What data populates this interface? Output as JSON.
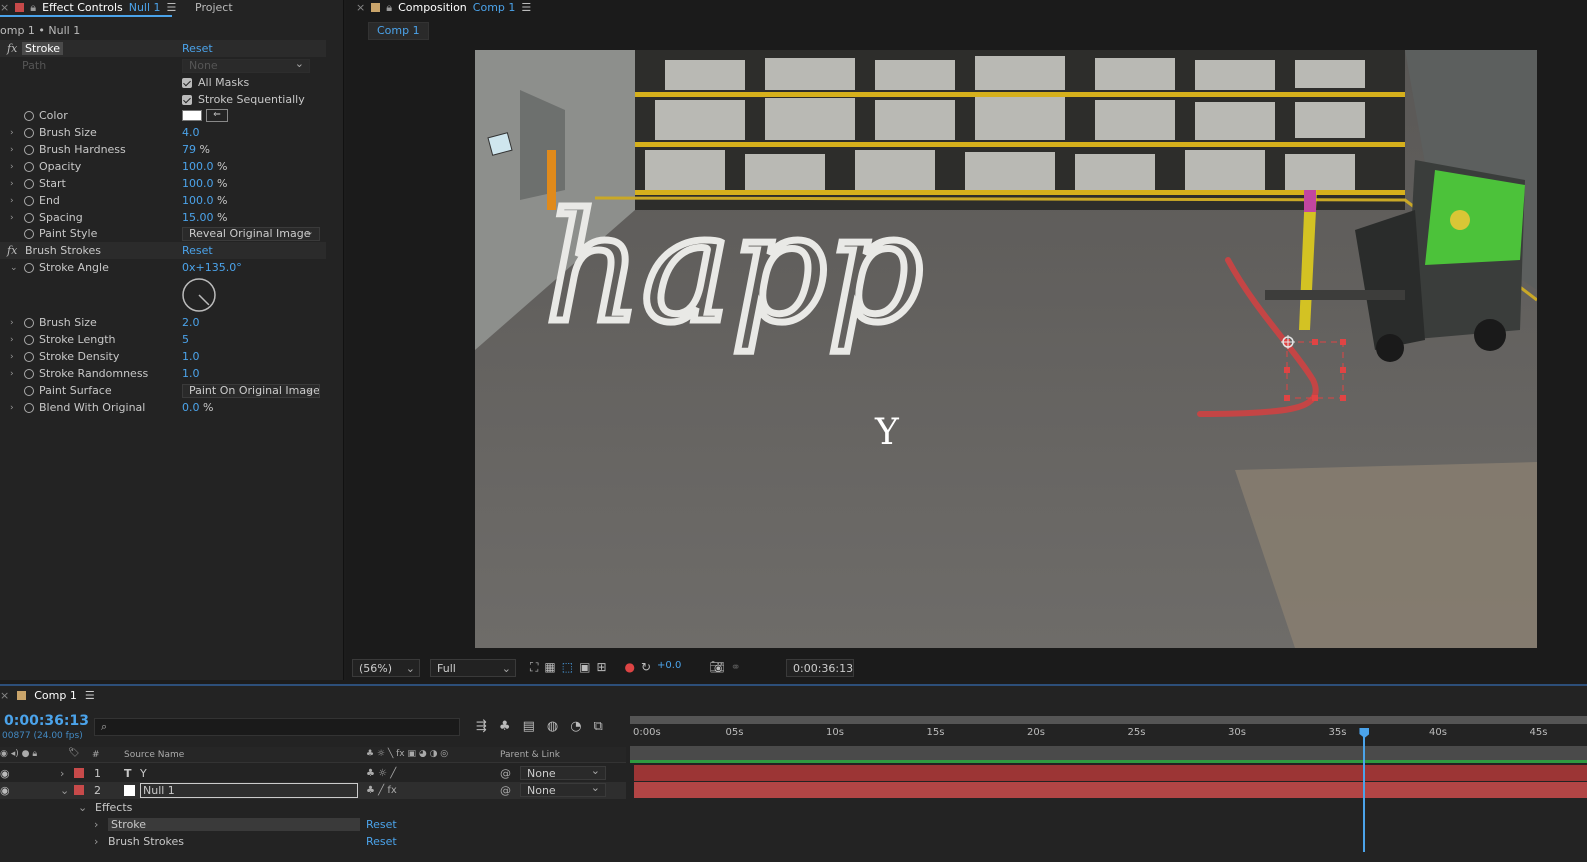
{
  "effect_controls": {
    "tab_title": "Effect Controls",
    "tab_layer": "Null 1",
    "project_tab": "Project",
    "breadcrumb": "omp 1 • Null 1",
    "stroke": {
      "name": "Stroke",
      "reset": "Reset",
      "path_label": "Path",
      "path_value": "None",
      "all_masks": "All Masks",
      "stroke_sequentially": "Stroke Sequentially",
      "color_label": "Color",
      "color_value": "#ffffff",
      "props": [
        {
          "label": "Brush Size",
          "value": "4.0",
          "unit": ""
        },
        {
          "label": "Brush Hardness",
          "value": "79",
          "unit": "%"
        },
        {
          "label": "Opacity",
          "value": "100.0",
          "unit": "%"
        },
        {
          "label": "Start",
          "value": "100.0",
          "unit": "%"
        },
        {
          "label": "End",
          "value": "100.0",
          "unit": "%"
        },
        {
          "label": "Spacing",
          "value": "15.00",
          "unit": "%"
        }
      ],
      "paint_style_label": "Paint Style",
      "paint_style_value": "Reveal Original Image"
    },
    "brush_strokes": {
      "name": "Brush Strokes",
      "reset": "Reset",
      "angle_label": "Stroke Angle",
      "angle_value": "0x+135.0°",
      "angle_degrees": 135,
      "props": [
        {
          "label": "Brush Size",
          "value": "2.0",
          "unit": ""
        },
        {
          "label": "Stroke Length",
          "value": "5",
          "unit": ""
        },
        {
          "label": "Stroke Density",
          "value": "1.0",
          "unit": ""
        },
        {
          "label": "Stroke Randomness",
          "value": "1.0",
          "unit": ""
        }
      ],
      "paint_surface_label": "Paint Surface",
      "paint_surface_value": "Paint On Original Image",
      "blend_label": "Blend With Original",
      "blend_value": "0.0",
      "blend_unit": "%"
    }
  },
  "composition": {
    "tab_title": "Composition",
    "tab_comp": "Comp 1",
    "sub_tab": "Comp 1",
    "viewer_text": "happ",
    "viewer_letter": "Y",
    "zoom": "(56%)",
    "resolution": "Full",
    "exposure": "+0.0",
    "timecode": "0:00:36:13"
  },
  "timeline": {
    "tab": "Comp 1",
    "timecode": "0:00:36:13",
    "frames": "00877 (24.00 fps)",
    "search_placeholder": "",
    "col_num": "#",
    "col_source": "Source Name",
    "col_parent": "Parent & Link",
    "ruler": [
      "0:00s",
      "05s",
      "10s",
      "15s",
      "20s",
      "25s",
      "30s",
      "35s",
      "40s",
      "45s"
    ],
    "playhead_seconds": 36.54,
    "layers": [
      {
        "num": "1",
        "type": "T",
        "name": "Y",
        "color": "#c74a4a",
        "parent": "None"
      },
      {
        "num": "2",
        "type": "",
        "name": "Null 1",
        "color": "#c74a4a",
        "parent": "None"
      }
    ],
    "effects_label": "Effects",
    "effect_rows": [
      {
        "name": "Stroke",
        "reset": "Reset"
      },
      {
        "name": "Brush Strokes",
        "reset": "Reset"
      }
    ]
  }
}
